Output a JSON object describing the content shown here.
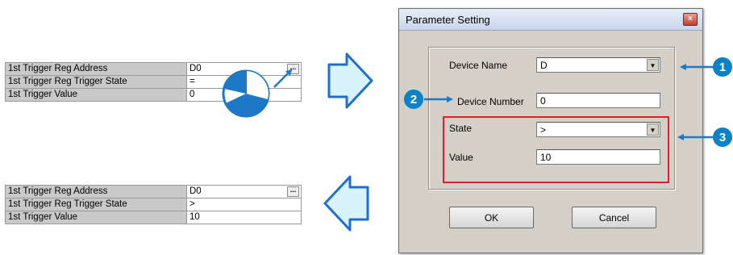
{
  "before_table": {
    "rows": [
      {
        "label": "1st Trigger Reg Address",
        "value": "D0"
      },
      {
        "label": "1st Trigger Reg Trigger State",
        "value": "="
      },
      {
        "label": "1st Trigger Value",
        "value": "0"
      }
    ],
    "ellipsis_label": "..."
  },
  "after_table": {
    "rows": [
      {
        "label": "1st Trigger Reg Address",
        "value": "D0"
      },
      {
        "label": "1st Trigger Reg Trigger State",
        "value": ">"
      },
      {
        "label": "1st Trigger Value",
        "value": "10"
      }
    ],
    "ellipsis_label": "..."
  },
  "dialog": {
    "title": "Parameter Setting",
    "close_glyph": "×",
    "device_name_label": "Device Name",
    "device_name_value": "D",
    "device_number_label": "Device Number",
    "device_number_value": "0",
    "state_label": "State",
    "state_value": ">",
    "value_label": "Value",
    "value_value": "10",
    "ok_label": "OK",
    "cancel_label": "Cancel",
    "dropdown_glyph": "▼"
  },
  "callouts": [
    "1",
    "2",
    "3"
  ],
  "colors": {
    "callout": "#0b82c7",
    "arrow_fill": "#d9f3fb",
    "highlight": "#e31e2b"
  }
}
